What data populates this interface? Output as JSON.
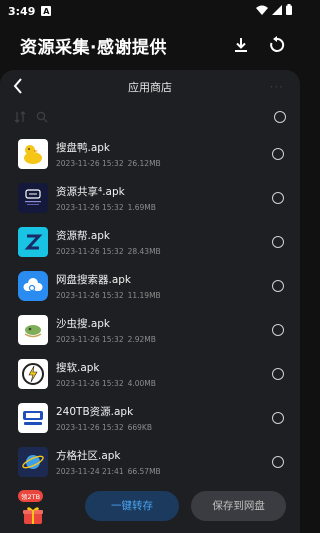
{
  "status_bar": {
    "time": "3:49",
    "notification": "A"
  },
  "header": {
    "app_title": "资源采集·感谢提供"
  },
  "sheet": {
    "folder_name": "应用商店",
    "more": "···",
    "files": [
      {
        "name": "搜盘鸭.apk",
        "date": "2023-11-26 15:32",
        "size": "26.12MB",
        "icon": "duck-icon"
      },
      {
        "name": "资源共享⁴.apk",
        "date": "2023-11-26 15:32",
        "size": "1.69MB",
        "icon": "resource-share-icon"
      },
      {
        "name": "资源帮.apk",
        "date": "2023-11-26 15:32",
        "size": "28.43MB",
        "icon": "z-icon"
      },
      {
        "name": "网盘搜索器.apk",
        "date": "2023-11-26 15:32",
        "size": "11.19MB",
        "icon": "cloud-search-icon"
      },
      {
        "name": "沙虫搜.apk",
        "date": "2023-11-26 15:32",
        "size": "2.92MB",
        "icon": "sandworm-icon"
      },
      {
        "name": "搜软.apk",
        "date": "2023-11-26 15:32",
        "size": "4.00MB",
        "icon": "lightning-icon"
      },
      {
        "name": "240TB资源.apk",
        "date": "2023-11-26 15:32",
        "size": "669KB",
        "icon": "240tb-icon"
      },
      {
        "name": "方格社区.apk",
        "date": "2023-11-24 21:41",
        "size": "66.57MB",
        "icon": "planet-icon"
      }
    ]
  },
  "bottom": {
    "gift_badge": "领2TB",
    "save_button": "一键转存",
    "save_to_disk_button": "保存到网盘"
  },
  "colors": {
    "background": "#111111",
    "sheet": "#1e1f23",
    "accent": "#4aa3f0",
    "badge": "#e9473d"
  }
}
